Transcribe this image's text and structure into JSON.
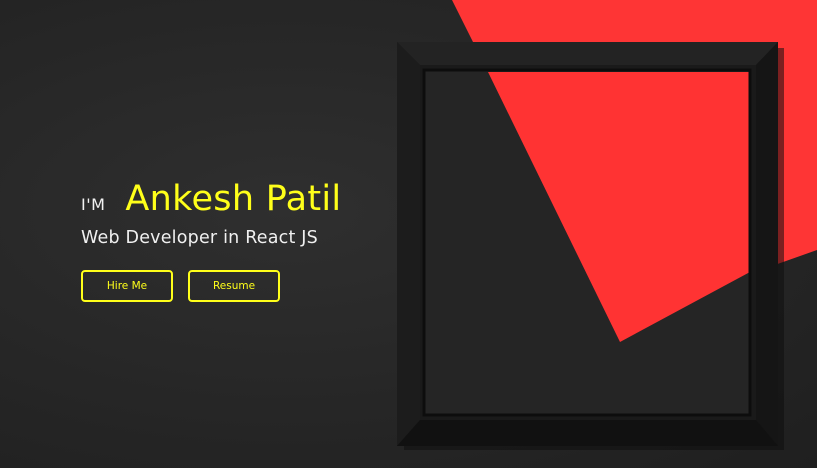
{
  "hero": {
    "prefix": "I'M",
    "name": "Ankesh Patil",
    "role": "Web Developer in React JS",
    "buttons": {
      "hire_label": "Hire Me",
      "resume_label": "Resume"
    }
  },
  "colors": {
    "accent": "#ffff1a",
    "background": "#2a2a2a",
    "paper_red": "#ff3636",
    "frame": "#161616",
    "text": "#f0f0f0"
  },
  "icons": [
    "picture-frame-icon"
  ]
}
